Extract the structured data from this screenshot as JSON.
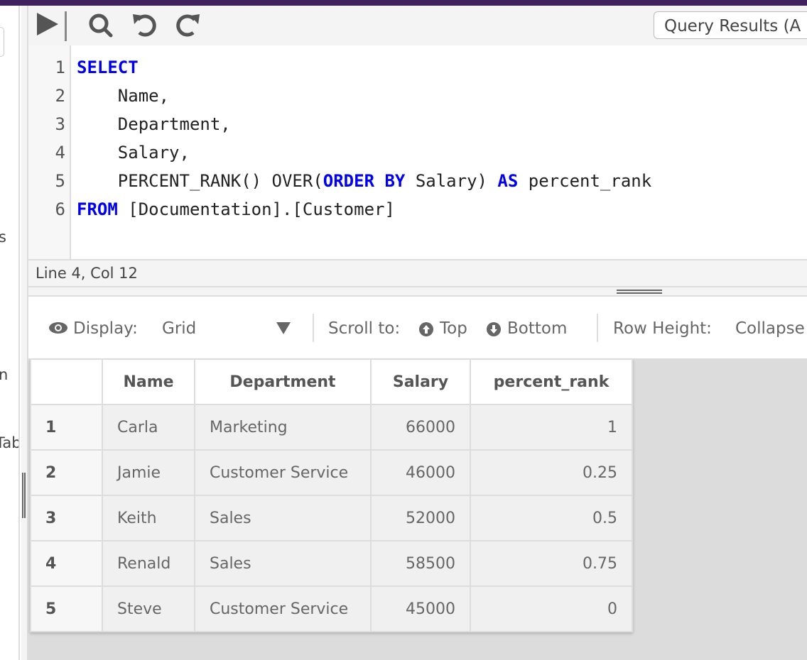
{
  "sidebar": {
    "fragments": [
      "s",
      "n",
      "Tab"
    ]
  },
  "toolbar": {
    "icons": [
      "run-icon",
      "search-icon",
      "undo-icon",
      "redo-icon"
    ],
    "results_label": "Query Results (A"
  },
  "editor": {
    "line_numbers": [
      "1",
      "2",
      "3",
      "4",
      "5",
      "6"
    ],
    "lines": [
      [
        {
          "t": "SELECT",
          "kw": true
        }
      ],
      [
        {
          "t": "    Name,",
          "kw": false
        }
      ],
      [
        {
          "t": "    Department,",
          "kw": false
        }
      ],
      [
        {
          "t": "    Salary,",
          "kw": false
        }
      ],
      [
        {
          "t": "    PERCENT_RANK() OVER(",
          "kw": false
        },
        {
          "t": "ORDER BY",
          "kw": true
        },
        {
          "t": " Salary) ",
          "kw": false
        },
        {
          "t": "AS",
          "kw": true
        },
        {
          "t": " percent_rank",
          "kw": false
        }
      ],
      [
        {
          "t": "FROM",
          "kw": true
        },
        {
          "t": " [Documentation].[Customer]",
          "kw": false
        }
      ]
    ],
    "keyword_color": "#0000ee"
  },
  "status": {
    "position": "Line 4, Col 12"
  },
  "results_toolbar": {
    "display_label": "Display:",
    "display_value": "Grid",
    "scroll_label": "Scroll to:",
    "top": "Top",
    "bottom": "Bottom",
    "row_height_label": "Row Height:",
    "row_height_value": "Collapse"
  },
  "grid": {
    "columns": [
      "",
      "Name",
      "Department",
      "Salary",
      "percent_rank"
    ],
    "rows": [
      [
        "1",
        "Carla",
        "Marketing",
        "66000",
        "1"
      ],
      [
        "2",
        "Jamie",
        "Customer Service",
        "46000",
        "0.25"
      ],
      [
        "3",
        "Keith",
        "Sales",
        "52000",
        "0.5"
      ],
      [
        "4",
        "Renald",
        "Sales",
        "58500",
        "0.75"
      ],
      [
        "5",
        "Steve",
        "Customer Service",
        "45000",
        "0"
      ]
    ]
  },
  "colors": {
    "topbar": "#3f2160"
  }
}
